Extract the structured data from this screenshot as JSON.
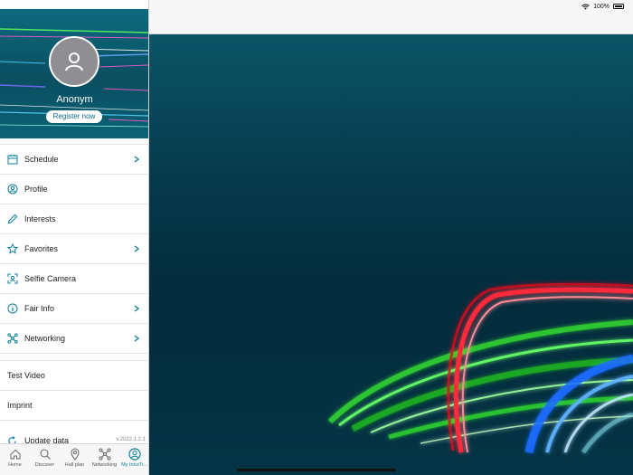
{
  "status_bar": {
    "battery_text": "100%"
  },
  "profile": {
    "name": "Anonym",
    "register_label": "Register now"
  },
  "menu": [
    {
      "label": "Schedule",
      "icon": "calendar-icon",
      "chevron": true
    },
    {
      "label": "Profile",
      "icon": "profile-icon",
      "chevron": false
    },
    {
      "label": "Interests",
      "icon": "pencil-icon",
      "chevron": false
    },
    {
      "label": "Favorites",
      "icon": "star-icon",
      "chevron": true
    },
    {
      "label": "Selfie Camera",
      "icon": "selfie-camera-icon",
      "chevron": false
    },
    {
      "label": "Fair Info",
      "icon": "info-icon",
      "chevron": true
    },
    {
      "label": "Networking",
      "icon": "network-icon",
      "chevron": true
    }
  ],
  "extra_items": {
    "test_video": "Test Video",
    "imprint": "Imprint",
    "update_data": "Update data"
  },
  "version": "v.2022.1.2.1",
  "tabs": [
    {
      "label": "Home",
      "icon": "home-icon"
    },
    {
      "label": "Discover",
      "icon": "search-icon"
    },
    {
      "label": "Hall plan",
      "icon": "map-pin-icon"
    },
    {
      "label": "Networking",
      "icon": "network-icon"
    },
    {
      "label": "My InnoTr...",
      "icon": "profile-icon",
      "active": true
    }
  ],
  "colors": {
    "accent": "#0b7f98",
    "header_bg": "#0a4e60",
    "main_bg": "#043446"
  }
}
